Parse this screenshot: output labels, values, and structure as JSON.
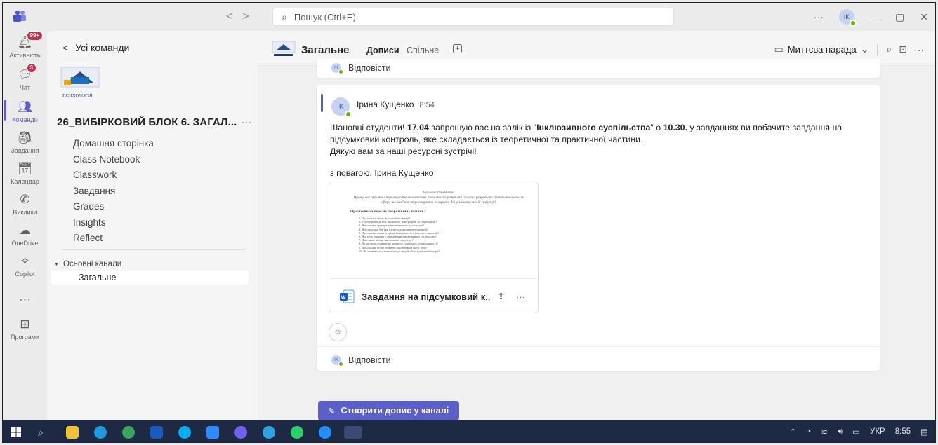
{
  "search": {
    "placeholder": "Пошук (Ctrl+E)"
  },
  "titlebar": {
    "avatar": "IK",
    "more": "···",
    "minimize": "—",
    "restore": "▢",
    "close": "✕"
  },
  "rail": [
    {
      "label": "Активність",
      "icon": "bell-icon",
      "badge": "99+"
    },
    {
      "label": "Чат",
      "icon": "chat-icon",
      "badge": "3"
    },
    {
      "label": "Команди",
      "icon": "teams-icon",
      "badge": ""
    },
    {
      "label": "Завдання",
      "icon": "assignments-icon",
      "badge": ""
    },
    {
      "label": "Календар",
      "icon": "calendar-icon",
      "badge": ""
    },
    {
      "label": "Виклики",
      "icon": "phone-icon",
      "badge": ""
    },
    {
      "label": "OneDrive",
      "icon": "cloud-icon",
      "badge": ""
    },
    {
      "label": "Copilot",
      "icon": "copilot-icon",
      "badge": ""
    },
    {
      "label": "",
      "icon": "more-icon",
      "badge": ""
    },
    {
      "label": "Програми",
      "icon": "apps-icon",
      "badge": ""
    }
  ],
  "teampanel": {
    "back": "Усі команди",
    "logo_text": "ПСИХОЛОГІЯ",
    "team_name": "26_ВИБІРКОВИЙ БЛОК 6. ЗАГАЛ...",
    "items": [
      "Домашня сторінка",
      "Class Notebook",
      "Classwork",
      "Завдання",
      "Grades",
      "Insights",
      "Reflect"
    ],
    "channels_header": "Основні канали",
    "channel": "Загальне"
  },
  "header": {
    "title": "Загальне",
    "tabs": [
      "Дописи",
      "Спільне"
    ],
    "add_tab": "+",
    "meet": "Миттєва нарада"
  },
  "post_prev": {
    "reply": "Відповісти",
    "avatar": "IK"
  },
  "post": {
    "avatar": "IK",
    "author": "Ірина Кущенко",
    "time": "8:54",
    "m1": "Шановні студенти! ",
    "m2": "17.04",
    "m3": " запрошую вас на залік із \"",
    "m4": "Інклюзивного суспільства",
    "m5": "\" о ",
    "m6": "10.30.",
    "m7": " у завданнях ви побачите завдання на підсумковий контроль, яке складається із теоретичної та практичної частини.",
    "m8": "Дякую вам за наші ресурсні зустрічі!",
    "sign": "з повагою, Ірина Кущенко",
    "attachment": {
      "name": "Завдання на підсумковий к...",
      "doc_title": "Шановні студенти!",
      "doc_intro": "Прошу вас обрати з переліку одне теоретичне питання та розкрити його та розробити практичний кейс із сфери інклюзії та запропонувати алгоритм дій у змодельованій ситуації!",
      "doc_heading": "Орієнтовний перелік теоретичних питань:",
      "doc_lines": [
        "1. Що таке інклюзія як соціальне явище?",
        "2. У чому різниця між інклюзією, інтеграцією та сегрегацією?",
        "3. Які основні принципи інклюзивного суспільства?",
        "4. Які соціальні бар'єри існують для розвитку інклюзії?",
        "5. Що означає поняття «рівні можливості» в контексті інклюзії?",
        "6. Яка роль держави у формуванні інклюзивного суспільства?",
        "7. Які етичні засади інклюзивного підходу?",
        "8. Як інклюзія впливає на розвиток соціальної справедливості?",
        "9. Які основні етапи розвитку інклюзивної ідеї у світі?",
        "10. Як змінювалося ставлення до людей з інвалідністю в історії?"
      ]
    },
    "reply": "Відповісти"
  },
  "new_post": "Створити допис у каналі",
  "taskbar": {
    "lang": "УКР",
    "time": "8:55"
  }
}
